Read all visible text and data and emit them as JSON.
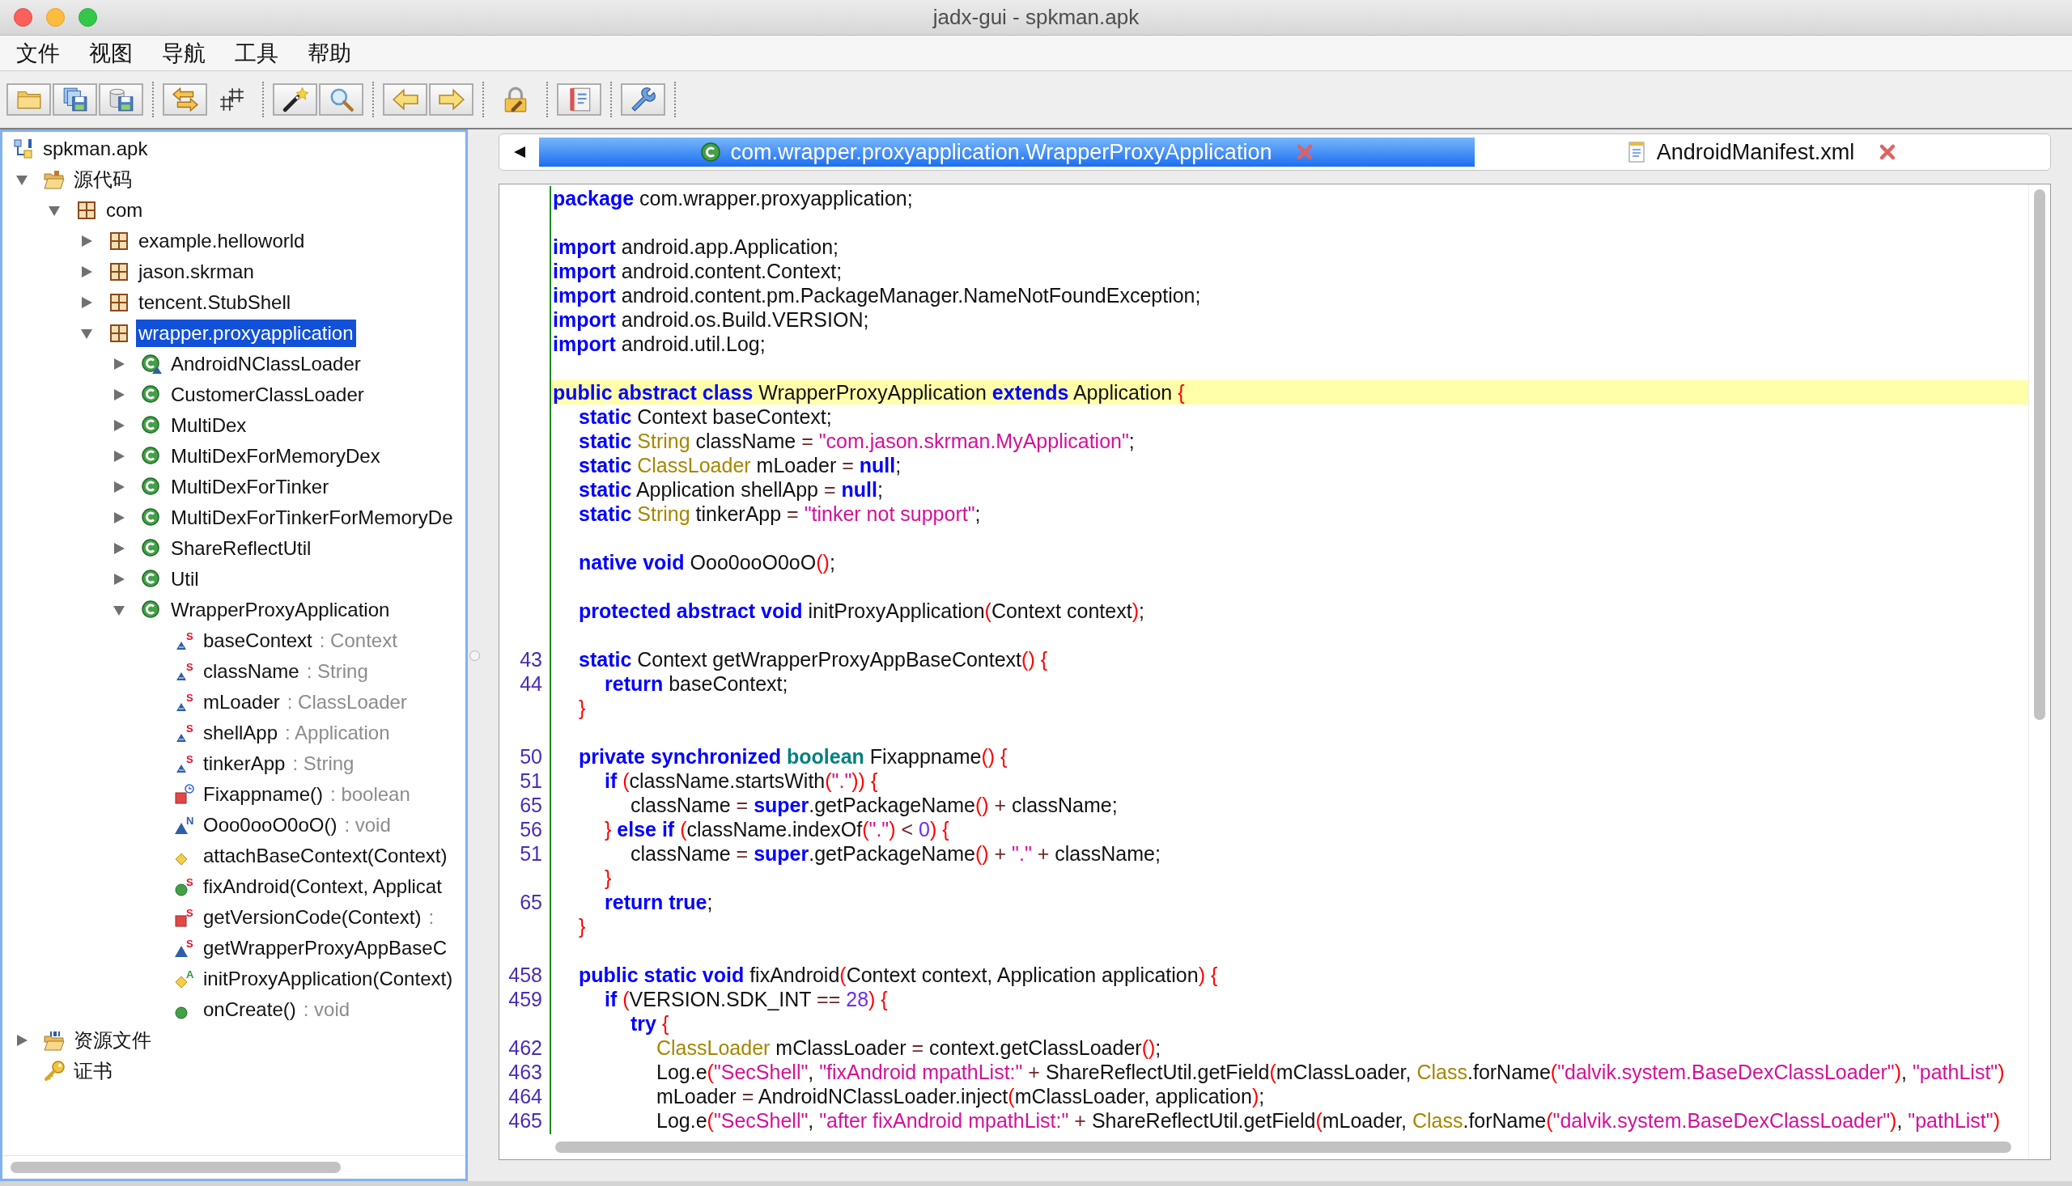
{
  "window": {
    "title": "jadx-gui - spkman.apk"
  },
  "menu": [
    "文件",
    "视图",
    "导航",
    "工具",
    "帮助"
  ],
  "toolbar": {
    "groups": [
      {
        "items": [
          {
            "kind": "open",
            "bordered": true
          },
          {
            "kind": "save-all",
            "bordered": true
          },
          {
            "kind": "export",
            "bordered": true
          }
        ]
      },
      {
        "items": [
          {
            "kind": "sync",
            "bordered": true
          },
          {
            "kind": "flatten",
            "bordered": false
          }
        ]
      },
      {
        "items": [
          {
            "kind": "decompile",
            "bordered": true
          },
          {
            "kind": "search",
            "bordered": true
          }
        ]
      },
      {
        "items": [
          {
            "kind": "back",
            "bordered": true
          },
          {
            "kind": "forward",
            "bordered": true
          }
        ]
      },
      {
        "items": [
          {
            "kind": "deobfuscate",
            "bordered": false
          }
        ]
      },
      {
        "items": [
          {
            "kind": "log",
            "bordered": true
          }
        ]
      },
      {
        "items": [
          {
            "kind": "preferences",
            "bordered": true
          }
        ]
      }
    ]
  },
  "tree": {
    "root": {
      "label": "spkman.apk",
      "kind": "apk",
      "selected": false,
      "children": [
        {
          "label": "源代码",
          "kind": "sources",
          "expanded": true,
          "selected": false,
          "children": [
            {
              "label": "com",
              "kind": "package",
              "expanded": true,
              "selected": false,
              "children": [
                {
                  "label": "example.helloworld",
                  "kind": "package",
                  "expanded": false,
                  "selected": false
                },
                {
                  "label": "jason.skrman",
                  "kind": "package",
                  "expanded": false,
                  "selected": false
                },
                {
                  "label": "tencent.StubShell",
                  "kind": "package",
                  "expanded": false,
                  "selected": false
                },
                {
                  "label": "wrapper.proxyapplication",
                  "kind": "package",
                  "expanded": true,
                  "selected": true,
                  "children": [
                    {
                      "label": "AndroidNClassLoader",
                      "kind": "package-class",
                      "expanded": false,
                      "selected": false
                    },
                    {
                      "label": "CustomerClassLoader",
                      "kind": "public-class",
                      "expanded": false,
                      "selected": false
                    },
                    {
                      "label": "MultiDex",
                      "kind": "public-class",
                      "expanded": false,
                      "selected": false
                    },
                    {
                      "label": "MultiDexForMemoryDex",
                      "kind": "public-class",
                      "expanded": false,
                      "selected": false
                    },
                    {
                      "label": "MultiDexForTinker",
                      "kind": "public-class",
                      "expanded": false,
                      "selected": false
                    },
                    {
                      "label": "MultiDexForTinkerForMemoryDe",
                      "kind": "public-class",
                      "expanded": false,
                      "selected": false
                    },
                    {
                      "label": "ShareReflectUtil",
                      "kind": "public-class",
                      "expanded": false,
                      "selected": false
                    },
                    {
                      "label": "Util",
                      "kind": "public-class",
                      "expanded": false,
                      "selected": false
                    },
                    {
                      "label": "WrapperProxyApplication",
                      "kind": "public-class",
                      "expanded": true,
                      "selected": false,
                      "children": [
                        {
                          "label": "baseContext",
                          "detail": ": Context",
                          "kind": "package-field",
                          "modifier": {
                            "kind": "static",
                            "letter": "S"
                          },
                          "selected": false
                        },
                        {
                          "label": "className",
                          "detail": ": String",
                          "kind": "package-field",
                          "modifier": {
                            "kind": "static",
                            "letter": "S"
                          },
                          "selected": false
                        },
                        {
                          "label": "mLoader",
                          "detail": ": ClassLoader",
                          "kind": "package-field",
                          "modifier": {
                            "kind": "static",
                            "letter": "S"
                          },
                          "selected": false
                        },
                        {
                          "label": "shellApp",
                          "detail": ": Application",
                          "kind": "package-field",
                          "modifier": {
                            "kind": "static",
                            "letter": "S"
                          },
                          "selected": false
                        },
                        {
                          "label": "tinkerApp",
                          "detail": ": String",
                          "kind": "package-field",
                          "modifier": {
                            "kind": "static",
                            "letter": "S"
                          },
                          "selected": false
                        },
                        {
                          "label": "Fixappname()",
                          "detail": ": boolean",
                          "kind": "private-method",
                          "modifier": {
                            "kind": "synchronized"
                          },
                          "selected": false
                        },
                        {
                          "label": "Ooo0ooO0oO()",
                          "detail": ": void",
                          "kind": "package-method",
                          "modifier": {
                            "kind": "native",
                            "letter": "N"
                          },
                          "selected": false
                        },
                        {
                          "label": "attachBaseContext(Context)",
                          "kind": "protected-method",
                          "selected": false
                        },
                        {
                          "label": "fixAndroid(Context, Applicat",
                          "kind": "public-method",
                          "modifier": {
                            "kind": "static",
                            "letter": "S"
                          },
                          "selected": false
                        },
                        {
                          "label": "getVersionCode(Context)",
                          "detail": ":",
                          "kind": "private-method",
                          "modifier": {
                            "kind": "static",
                            "letter": "S"
                          },
                          "selected": false
                        },
                        {
                          "label": "getWrapperProxyAppBaseC",
                          "kind": "package-method",
                          "modifier": {
                            "kind": "static",
                            "letter": "S"
                          },
                          "selected": false
                        },
                        {
                          "label": "initProxyApplication(Context)",
                          "kind": "protected-method",
                          "modifier": {
                            "kind": "abstract",
                            "letter": "A"
                          },
                          "selected": false
                        },
                        {
                          "label": "onCreate()",
                          "detail": ": void",
                          "kind": "public-method",
                          "selected": false
                        }
                      ]
                    }
                  ]
                }
              ]
            }
          ]
        },
        {
          "label": "资源文件",
          "kind": "resources",
          "expanded": false,
          "selected": false
        },
        {
          "label": "证书",
          "kind": "certificates",
          "selected": false
        }
      ]
    }
  },
  "editor": {
    "tabs": [
      {
        "label": "com.wrapper.proxyapplication.WrapperProxyApplication",
        "kind": "class",
        "selected": true
      },
      {
        "label": "AndroidManifest.xml",
        "kind": "xml",
        "selected": false
      }
    ],
    "lines": [
      {
        "kind": "code",
        "current": false,
        "tokens": [
          {
            "kind": "keyword",
            "text": "package"
          },
          {
            "kind": "plain",
            "text": " com.wrapper.proxyapplication;"
          }
        ]
      },
      {
        "kind": "blank",
        "current": false
      },
      {
        "kind": "code",
        "current": false,
        "tokens": [
          {
            "kind": "keyword",
            "text": "import"
          },
          {
            "kind": "plain",
            "text": " android.app.Application;"
          }
        ]
      },
      {
        "kind": "code",
        "current": false,
        "tokens": [
          {
            "kind": "keyword",
            "text": "import"
          },
          {
            "kind": "plain",
            "text": " android.content.Context;"
          }
        ]
      },
      {
        "kind": "code",
        "current": false,
        "tokens": [
          {
            "kind": "keyword",
            "text": "import"
          },
          {
            "kind": "plain",
            "text": " android.content.pm.PackageManager.NameNotFoundException;"
          }
        ]
      },
      {
        "kind": "code",
        "current": false,
        "tokens": [
          {
            "kind": "keyword",
            "text": "import"
          },
          {
            "kind": "plain",
            "text": " android.os.Build.VERSION;"
          }
        ]
      },
      {
        "kind": "code",
        "current": false,
        "tokens": [
          {
            "kind": "keyword",
            "text": "import"
          },
          {
            "kind": "plain",
            "text": " android.util.Log;"
          }
        ]
      },
      {
        "kind": "blank",
        "current": false
      },
      {
        "kind": "code",
        "current": true,
        "tokens": [
          {
            "kind": "keyword",
            "text": "public abstract class"
          },
          {
            "kind": "plain",
            "text": " WrapperProxyApplication "
          },
          {
            "kind": "keyword",
            "text": "extends"
          },
          {
            "kind": "plain",
            "text": " Application "
          },
          {
            "kind": "bracket",
            "text": "{"
          }
        ],
        "children": [
          {
            "kind": "code",
            "current": false,
            "tokens": [
              {
                "kind": "keyword",
                "text": "static"
              },
              {
                "kind": "plain",
                "text": " Context baseContext;"
              }
            ]
          },
          {
            "kind": "code",
            "current": false,
            "tokens": [
              {
                "kind": "keyword",
                "text": "static "
              },
              {
                "kind": "type",
                "text": "String"
              },
              {
                "kind": "plain",
                "text": " className "
              },
              {
                "kind": "operator",
                "text": "= "
              },
              {
                "kind": "string",
                "text": "\"com.jason.skrman.MyApplication\""
              },
              {
                "kind": "plain",
                "text": ";"
              }
            ]
          },
          {
            "kind": "code",
            "current": false,
            "tokens": [
              {
                "kind": "keyword",
                "text": "static "
              },
              {
                "kind": "type",
                "text": "ClassLoader"
              },
              {
                "kind": "plain",
                "text": " mLoader "
              },
              {
                "kind": "operator",
                "text": "= "
              },
              {
                "kind": "keyword",
                "text": "null"
              },
              {
                "kind": "plain",
                "text": ";"
              }
            ]
          },
          {
            "kind": "code",
            "current": false,
            "tokens": [
              {
                "kind": "keyword",
                "text": "static"
              },
              {
                "kind": "plain",
                "text": " Application shellApp "
              },
              {
                "kind": "operator",
                "text": "= "
              },
              {
                "kind": "keyword",
                "text": "null"
              },
              {
                "kind": "plain",
                "text": ";"
              }
            ]
          },
          {
            "kind": "code",
            "current": false,
            "tokens": [
              {
                "kind": "keyword",
                "text": "static "
              },
              {
                "kind": "type",
                "text": "String"
              },
              {
                "kind": "plain",
                "text": " tinkerApp "
              },
              {
                "kind": "operator",
                "text": "= "
              },
              {
                "kind": "string",
                "text": "\"tinker not support\""
              },
              {
                "kind": "plain",
                "text": ";"
              }
            ]
          },
          {
            "kind": "blank",
            "current": false
          },
          {
            "kind": "code",
            "current": false,
            "tokens": [
              {
                "kind": "keyword",
                "text": "native void"
              },
              {
                "kind": "plain",
                "text": " Ooo0ooO0oO"
              },
              {
                "kind": "bracket",
                "text": "()"
              },
              {
                "kind": "plain",
                "text": ";"
              }
            ]
          },
          {
            "kind": "blank",
            "current": false
          },
          {
            "kind": "code",
            "current": false,
            "tokens": [
              {
                "kind": "keyword",
                "text": "protected abstract void"
              },
              {
                "kind": "plain",
                "text": " initProxyApplication"
              },
              {
                "kind": "bracket",
                "text": "("
              },
              {
                "kind": "plain",
                "text": "Context context"
              },
              {
                "kind": "bracket",
                "text": ")"
              },
              {
                "kind": "plain",
                "text": ";"
              }
            ]
          },
          {
            "kind": "blank",
            "current": false
          },
          {
            "kind": "code",
            "number": "43",
            "current": false,
            "tokens": [
              {
                "kind": "keyword",
                "text": "static"
              },
              {
                "kind": "plain",
                "text": " Context getWrapperProxyAppBaseContext"
              },
              {
                "kind": "bracket",
                "text": "() {"
              }
            ],
            "children": [
              {
                "kind": "code",
                "number": "44",
                "current": false,
                "tokens": [
                  {
                    "kind": "keyword",
                    "text": "return"
                  },
                  {
                    "kind": "plain",
                    "text": " baseContext;"
                  }
                ]
              }
            ]
          },
          {
            "kind": "code",
            "current": false,
            "tokens": [
              {
                "kind": "bracket",
                "text": "}"
              }
            ]
          },
          {
            "kind": "blank",
            "current": false
          },
          {
            "kind": "code",
            "number": "50",
            "current": false,
            "tokens": [
              {
                "kind": "keyword",
                "text": "private synchronized "
              },
              {
                "kind": "primitive",
                "text": "boolean"
              },
              {
                "kind": "plain",
                "text": " Fixappname"
              },
              {
                "kind": "bracket",
                "text": "() {"
              }
            ],
            "children": [
              {
                "kind": "code",
                "number": "51",
                "current": false,
                "tokens": [
                  {
                    "kind": "keyword",
                    "text": "if "
                  },
                  {
                    "kind": "bracket",
                    "text": "("
                  },
                  {
                    "kind": "plain",
                    "text": "className.startsWith"
                  },
                  {
                    "kind": "bracket",
                    "text": "("
                  },
                  {
                    "kind": "string",
                    "text": "\".\""
                  },
                  {
                    "kind": "bracket",
                    "text": ")) {"
                  }
                ],
                "children": [
                  {
                    "kind": "code",
                    "number": "65",
                    "current": false,
                    "tokens": [
                      {
                        "kind": "plain",
                        "text": "className "
                      },
                      {
                        "kind": "operator",
                        "text": "= "
                      },
                      {
                        "kind": "keyword",
                        "text": "super"
                      },
                      {
                        "kind": "plain",
                        "text": ".getPackageName"
                      },
                      {
                        "kind": "bracket",
                        "text": "()"
                      },
                      {
                        "kind": "operator",
                        "text": " + "
                      },
                      {
                        "kind": "plain",
                        "text": "className;"
                      }
                    ]
                  }
                ]
              },
              {
                "kind": "code",
                "number": "56",
                "current": false,
                "tokens": [
                  {
                    "kind": "bracket",
                    "text": "} "
                  },
                  {
                    "kind": "keyword",
                    "text": "else if "
                  },
                  {
                    "kind": "bracket",
                    "text": "("
                  },
                  {
                    "kind": "plain",
                    "text": "className.indexOf"
                  },
                  {
                    "kind": "bracket",
                    "text": "("
                  },
                  {
                    "kind": "string",
                    "text": "\".\""
                  },
                  {
                    "kind": "bracket",
                    "text": ")"
                  },
                  {
                    "kind": "operator",
                    "text": " < "
                  },
                  {
                    "kind": "number",
                    "text": "0"
                  },
                  {
                    "kind": "bracket",
                    "text": ") {"
                  }
                ],
                "children": [
                  {
                    "kind": "code",
                    "number": "51",
                    "current": false,
                    "tokens": [
                      {
                        "kind": "plain",
                        "text": "className "
                      },
                      {
                        "kind": "operator",
                        "text": "= "
                      },
                      {
                        "kind": "keyword",
                        "text": "super"
                      },
                      {
                        "kind": "plain",
                        "text": ".getPackageName"
                      },
                      {
                        "kind": "bracket",
                        "text": "()"
                      },
                      {
                        "kind": "operator",
                        "text": " + "
                      },
                      {
                        "kind": "string",
                        "text": "\".\""
                      },
                      {
                        "kind": "operator",
                        "text": " + "
                      },
                      {
                        "kind": "plain",
                        "text": "className;"
                      }
                    ]
                  }
                ]
              },
              {
                "kind": "code",
                "current": false,
                "tokens": [
                  {
                    "kind": "bracket",
                    "text": "}"
                  }
                ]
              },
              {
                "kind": "code",
                "number": "65",
                "current": false,
                "tokens": [
                  {
                    "kind": "keyword",
                    "text": "return true"
                  },
                  {
                    "kind": "plain",
                    "text": ";"
                  }
                ]
              }
            ]
          },
          {
            "kind": "code",
            "current": false,
            "tokens": [
              {
                "kind": "bracket",
                "text": "}"
              }
            ]
          },
          {
            "kind": "blank",
            "current": false
          },
          {
            "kind": "code",
            "number": "458",
            "current": false,
            "tokens": [
              {
                "kind": "keyword",
                "text": "public static void"
              },
              {
                "kind": "plain",
                "text": " fixAndroid"
              },
              {
                "kind": "bracket",
                "text": "("
              },
              {
                "kind": "plain",
                "text": "Context context, Application application"
              },
              {
                "kind": "bracket",
                "text": ") {"
              }
            ],
            "children": [
              {
                "kind": "code",
                "number": "459",
                "current": false,
                "tokens": [
                  {
                    "kind": "keyword",
                    "text": "if "
                  },
                  {
                    "kind": "bracket",
                    "text": "("
                  },
                  {
                    "kind": "plain",
                    "text": "VERSION.SDK_INT "
                  },
                  {
                    "kind": "operator",
                    "text": "== "
                  },
                  {
                    "kind": "number",
                    "text": "28"
                  },
                  {
                    "kind": "bracket",
                    "text": ") {"
                  }
                ],
                "children": [
                  {
                    "kind": "code",
                    "current": false,
                    "tokens": [
                      {
                        "kind": "keyword",
                        "text": "try "
                      },
                      {
                        "kind": "bracket",
                        "text": "{"
                      }
                    ],
                    "children": [
                      {
                        "kind": "code",
                        "number": "462",
                        "current": false,
                        "tokens": [
                          {
                            "kind": "type",
                            "text": "ClassLoader"
                          },
                          {
                            "kind": "plain",
                            "text": " mClassLoader "
                          },
                          {
                            "kind": "operator",
                            "text": "="
                          },
                          {
                            "kind": "plain",
                            "text": " context.getClassLoader"
                          },
                          {
                            "kind": "bracket",
                            "text": "()"
                          },
                          {
                            "kind": "plain",
                            "text": ";"
                          }
                        ]
                      },
                      {
                        "kind": "code",
                        "number": "463",
                        "current": false,
                        "tokens": [
                          {
                            "kind": "plain",
                            "text": "Log.e"
                          },
                          {
                            "kind": "bracket",
                            "text": "("
                          },
                          {
                            "kind": "string",
                            "text": "\"SecShell\""
                          },
                          {
                            "kind": "plain",
                            "text": ", "
                          },
                          {
                            "kind": "string",
                            "text": "\"fixAndroid mpathList:\""
                          },
                          {
                            "kind": "operator",
                            "text": " + "
                          },
                          {
                            "kind": "plain",
                            "text": "ShareReflectUtil.getField"
                          },
                          {
                            "kind": "bracket",
                            "text": "("
                          },
                          {
                            "kind": "plain",
                            "text": "mClassLoader, "
                          },
                          {
                            "kind": "type",
                            "text": "Class"
                          },
                          {
                            "kind": "plain",
                            "text": ".forName"
                          },
                          {
                            "kind": "bracket",
                            "text": "("
                          },
                          {
                            "kind": "string",
                            "text": "\"dalvik.system.BaseDexClassLoader\""
                          },
                          {
                            "kind": "bracket",
                            "text": ")"
                          },
                          {
                            "kind": "plain",
                            "text": ", "
                          },
                          {
                            "kind": "string",
                            "text": "\"pathList\""
                          },
                          {
                            "kind": "bracket",
                            "text": ")"
                          }
                        ]
                      },
                      {
                        "kind": "code",
                        "number": "464",
                        "current": false,
                        "tokens": [
                          {
                            "kind": "plain",
                            "text": "mLoader "
                          },
                          {
                            "kind": "operator",
                            "text": "="
                          },
                          {
                            "kind": "plain",
                            "text": " AndroidNClassLoader.inject"
                          },
                          {
                            "kind": "bracket",
                            "text": "("
                          },
                          {
                            "kind": "plain",
                            "text": "mClassLoader, application"
                          },
                          {
                            "kind": "bracket",
                            "text": ")"
                          },
                          {
                            "kind": "plain",
                            "text": ";"
                          }
                        ]
                      },
                      {
                        "kind": "code",
                        "number": "465",
                        "current": false,
                        "tokens": [
                          {
                            "kind": "plain",
                            "text": "Log.e"
                          },
                          {
                            "kind": "bracket",
                            "text": "("
                          },
                          {
                            "kind": "string",
                            "text": "\"SecShell\""
                          },
                          {
                            "kind": "plain",
                            "text": ", "
                          },
                          {
                            "kind": "string",
                            "text": "\"after fixAndroid mpathList:\""
                          },
                          {
                            "kind": "operator",
                            "text": " + "
                          },
                          {
                            "kind": "plain",
                            "text": "ShareReflectUtil.getField"
                          },
                          {
                            "kind": "bracket",
                            "text": "("
                          },
                          {
                            "kind": "plain",
                            "text": "mLoader, "
                          },
                          {
                            "kind": "type",
                            "text": "Class"
                          },
                          {
                            "kind": "plain",
                            "text": ".forName"
                          },
                          {
                            "kind": "bracket",
                            "text": "("
                          },
                          {
                            "kind": "string",
                            "text": "\"dalvik.system.BaseDexClassLoader\""
                          },
                          {
                            "kind": "bracket",
                            "text": ")"
                          },
                          {
                            "kind": "plain",
                            "text": ", "
                          },
                          {
                            "kind": "string",
                            "text": "\"pathList\""
                          },
                          {
                            "kind": "bracket",
                            "text": ")"
                          }
                        ]
                      }
                    ]
                  }
                ]
              }
            ]
          }
        ]
      }
    ]
  }
}
